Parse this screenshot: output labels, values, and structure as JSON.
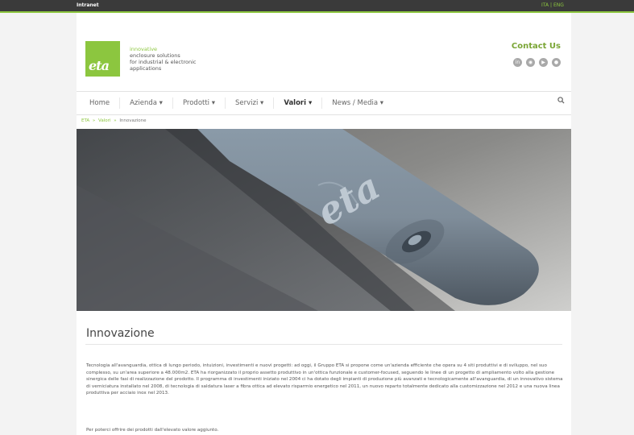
{
  "topbar": {
    "left_link": "Intranet",
    "lang_it": "ITA",
    "lang_sep": "|",
    "lang_en": "ENG"
  },
  "brand": {
    "logo_text": "eta",
    "tagline_1": "innovative",
    "tagline_2": "enclosure solutions",
    "tagline_3": "for industrial & electronic",
    "tagline_4": "applications",
    "accent_color": "#8cc63f"
  },
  "header": {
    "contact": "Contact Us",
    "social": [
      "linkedin-icon",
      "rss-icon",
      "youtube-icon",
      "instagram-icon"
    ]
  },
  "nav": {
    "items": [
      {
        "label": "Home"
      },
      {
        "label": "Azienda ▾"
      },
      {
        "label": "Prodotti ▾"
      },
      {
        "label": "Servizi ▾"
      },
      {
        "label": "Valori ▾"
      },
      {
        "label": "News / Media ▾"
      }
    ],
    "search_icon": "search-icon"
  },
  "breadcrumb": {
    "home": "ETA",
    "parent": "Valori",
    "current": "Innovazione",
    "sep": "»"
  },
  "hero": {
    "brand_mark": "eta"
  },
  "content": {
    "title": "Innovazione",
    "paragraph_1": "Tecnologia all'avanguardia, ottica di lungo periodo, intuizioni, investimenti e nuovi progetti: ad oggi, il Gruppo ETA si propone come un'azienda efficiente che opera su 4 siti produttivi e di sviluppo, nel suo complesso, su un'area superiore a 48.000m2. ETA ha riorganizzato il proprio assetto produttivo in un'ottica funzionale e customer-focused, seguendo le linee di un progetto di ampliamento volto alla gestione sinergica delle fasi di realizzazione del prodotto. Il programma di investimenti iniziato nel 2004 ci ha dotato degli impianti di produzione più avanzati e tecnologicamente all'avanguardia, di un innovativo sistema di verniciatura installato nel 2008, di tecnologia di saldatura laser a fibra ottica ad elevato risparmio energetico nel 2011, un nuovo reparto totalmente dedicato alla customizzazione nel 2012 e una nuova linea produttiva per acciaio inox nel 2013.",
    "paragraph_2": "Per poterci offrire dei prodotti dall'elevato valore aggiunto."
  }
}
